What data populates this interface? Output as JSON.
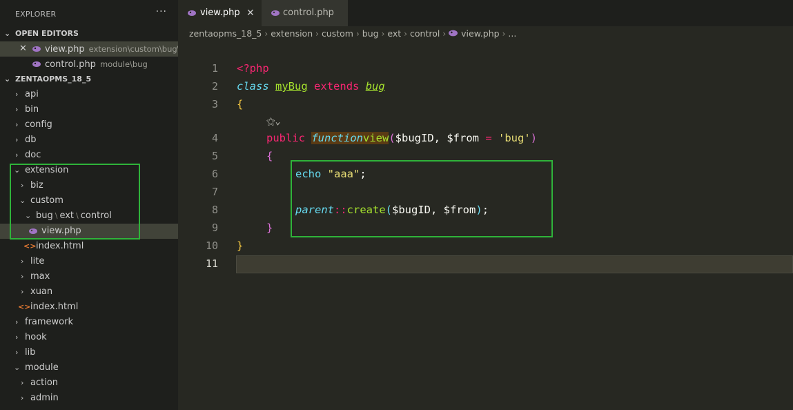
{
  "sidebar": {
    "title": "EXPLORER",
    "more": "···",
    "open_editors_label": "OPEN EDITORS",
    "open_editors": [
      {
        "name": "view.php",
        "desc": "extension\\custom\\bug\\..."
      },
      {
        "name": "control.php",
        "desc": "module\\bug"
      }
    ],
    "project_label": "ZENTAOPMS_18_5",
    "tree": {
      "api": "api",
      "bin": "bin",
      "config": "config",
      "db": "db",
      "doc": "doc",
      "extension": "extension",
      "biz": "biz",
      "custom": "custom",
      "bug": "bug",
      "ext": "ext",
      "control": "control",
      "view_php": "view.php",
      "index_html_1": "index.html",
      "lite": "lite",
      "max": "max",
      "xuan": "xuan",
      "index_html_2": "index.html",
      "framework": "framework",
      "hook": "hook",
      "lib": "lib",
      "module": "module",
      "action": "action",
      "admin": "admin"
    }
  },
  "tabs": [
    {
      "label": "view.php",
      "close": "✕"
    },
    {
      "label": "control.php"
    }
  ],
  "breadcrumb": [
    "zentaopms_18_5",
    "extension",
    "custom",
    "bug",
    "ext",
    "control",
    "view.php",
    "..."
  ],
  "editor": {
    "line_numbers": [
      "1",
      "2",
      "3",
      "4",
      "5",
      "6",
      "7",
      "8",
      "9",
      "10",
      "11"
    ],
    "tokens": {
      "php_open": "<?php",
      "class": "class",
      "myBug": "myBug",
      "extends": "extends",
      "bug": "bug",
      "open_brace": "{",
      "public": "public",
      "function": "function",
      "view": "view",
      "lparen": "(",
      "param1": "$bugID, ",
      "param2": "$from ",
      "eq": "=",
      "default": "'bug'",
      "rparen": ")",
      "open_brace_inner": "{",
      "echo": "echo",
      "str_aaa": "\"aaa\"",
      "semi": ";",
      "parent": "parent",
      "scope": "::",
      "create": "create",
      "lparen2": "(",
      "args": "$bugID, $from",
      "rparen2": ")",
      "semi2": ";",
      "close_brace_inner": "}",
      "close_brace": "}"
    },
    "ai_hint": "⚝⌄"
  },
  "colors": {
    "sidebar_bg": "#1e1f1c",
    "editor_bg": "#272822",
    "annotation_box": "#2fb33a",
    "php_icon": "#a074c4"
  }
}
